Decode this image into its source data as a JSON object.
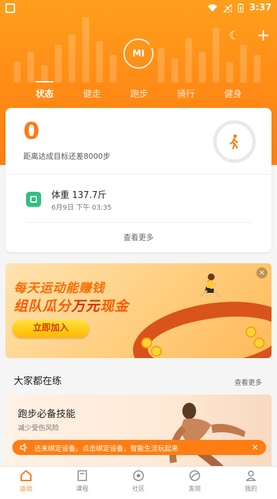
{
  "status_bar": {
    "time": "3:37"
  },
  "header": {
    "logo_text": "MI",
    "tabs": [
      {
        "label": "状态",
        "active": true
      },
      {
        "label": "健走",
        "active": false
      },
      {
        "label": "跑步",
        "active": false
      },
      {
        "label": "骑行",
        "active": false
      },
      {
        "label": "健身",
        "active": false
      }
    ]
  },
  "status_card": {
    "steps": "0",
    "goal_text": "距离达成目标还差8000步",
    "weight_label": "体重 137.7斤",
    "weight_time": "6月9日  下午 03:35",
    "more_label": "查看更多"
  },
  "banner": {
    "line1": "每天运动能赚钱",
    "line2_pre": "组队瓜分",
    "line2_hl": "万元",
    "line2_post": "现金",
    "button": "立即加入",
    "close": "×"
  },
  "section": {
    "title": "大家都在练",
    "more": "查看更多",
    "card_title": "跑步必备技能",
    "card_sub": "减少受伤风险"
  },
  "toast": {
    "text": "还未绑定设备。点击绑定设备，智能生活玩起来",
    "close": "✕"
  },
  "bottom_nav": [
    {
      "label": "运动",
      "active": true,
      "icon": "home-icon"
    },
    {
      "label": "课程",
      "active": false,
      "icon": "course-icon"
    },
    {
      "label": "社区",
      "active": false,
      "icon": "community-icon"
    },
    {
      "label": "发现",
      "active": false,
      "icon": "discover-icon"
    },
    {
      "label": "我的",
      "active": false,
      "icon": "profile-icon"
    }
  ],
  "colors": {
    "accent": "#ff8a15",
    "green": "#2ec27e"
  }
}
